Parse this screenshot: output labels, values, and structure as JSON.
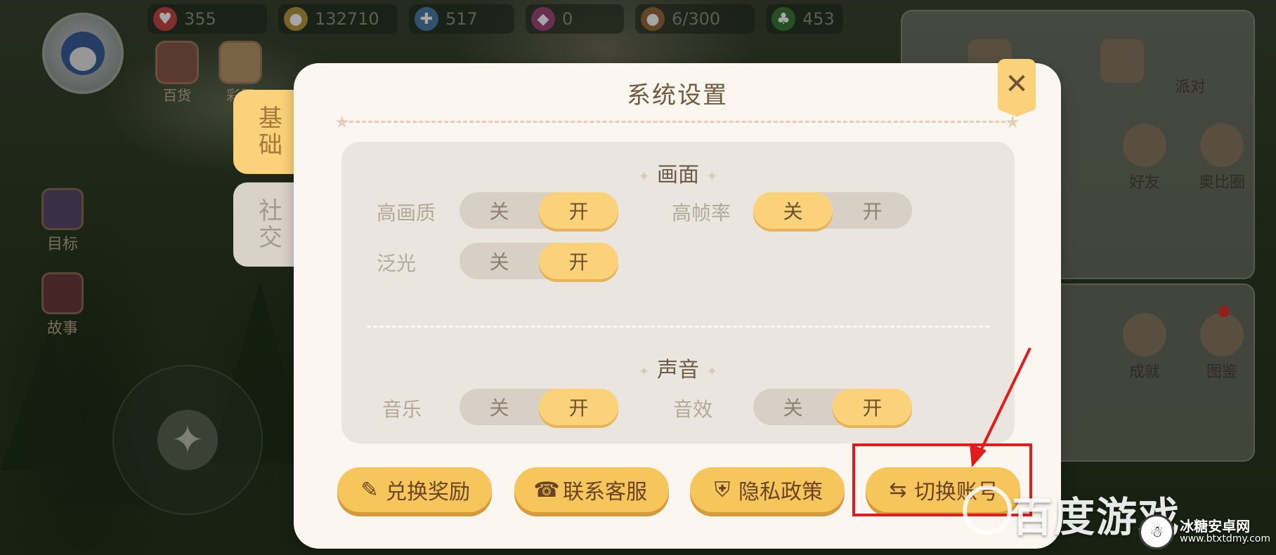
{
  "hud": {
    "resources": [
      {
        "icon": "heart-icon",
        "value": "355"
      },
      {
        "icon": "coin-icon",
        "value": "132710"
      },
      {
        "icon": "potion-icon",
        "value": "517"
      },
      {
        "icon": "gem-icon",
        "value": "0"
      },
      {
        "icon": "bear-icon",
        "value": "6/300"
      },
      {
        "icon": "clover-icon",
        "value": "453"
      }
    ],
    "top_icons": [
      {
        "label": "百货"
      },
      {
        "label": "彩蛋"
      }
    ],
    "left_icons": [
      {
        "label": "目标"
      },
      {
        "label": "故事"
      }
    ],
    "right_items": [
      {
        "label": "派对"
      },
      {
        "label": "好友"
      },
      {
        "label": "奥比圈"
      },
      {
        "label": "成就"
      },
      {
        "label": "图鉴"
      }
    ]
  },
  "side_tabs": {
    "basic": "基础",
    "social": "社交"
  },
  "dialog": {
    "title": "系统设置",
    "close": "✕",
    "sections": {
      "graphics": {
        "title": "画面",
        "high_quality": {
          "label": "高画质",
          "off": "关",
          "on": "开",
          "value": "on"
        },
        "high_framerate": {
          "label": "高帧率",
          "off": "关",
          "on": "开",
          "value": "off"
        },
        "bloom": {
          "label": "泛光",
          "off": "关",
          "on": "开",
          "value": "on"
        }
      },
      "sound": {
        "title": "声音",
        "music": {
          "label": "音乐",
          "off": "关",
          "on": "开",
          "value": "on"
        },
        "effects": {
          "label": "音效",
          "off": "关",
          "on": "开",
          "value": "on"
        }
      }
    },
    "buttons": {
      "redeem": "兑换奖励",
      "support": "联系客服",
      "privacy": "隐私政策",
      "switch_account": "切换账号"
    }
  },
  "watermarks": {
    "baidu": "百度游戏",
    "site_name": "冰糖安卓网",
    "site_url": "www.btxtdmy.com"
  },
  "colors": {
    "accent": "#fbd27a",
    "button": "#f6c55b",
    "highlight": "#e21b1b"
  }
}
